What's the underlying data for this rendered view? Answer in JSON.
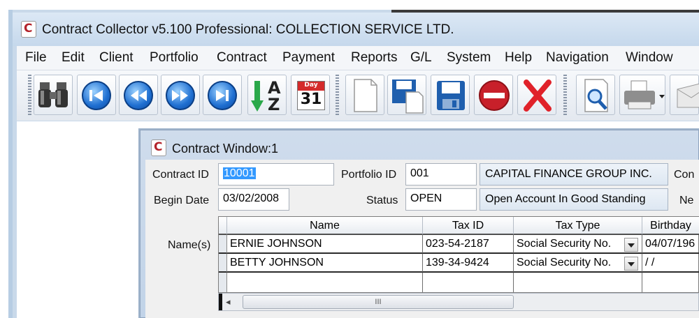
{
  "app": {
    "title": "Contract Collector v5.100 Professional:  COLLECTION SERVICE LTD."
  },
  "menu": [
    "File",
    "Edit",
    "Client",
    "Portfolio",
    "Contract",
    "Payment",
    "Reports",
    "G/L",
    "System",
    "Help",
    "Navigation",
    "Window"
  ],
  "toolbar": {
    "buttons": [
      "binoculars-icon",
      "first-record-icon",
      "previous-record-icon",
      "next-record-icon",
      "last-record-icon",
      "sort-az-icon",
      "calendar-icon",
      "new-document-icon",
      "save-as-icon",
      "save-icon",
      "stop-icon",
      "delete-icon",
      "print-preview-icon",
      "print-icon",
      "email-icon"
    ],
    "sort_a": "A",
    "sort_z": "Z",
    "calendar_header": "Day",
    "calendar_day": "31"
  },
  "contract_window": {
    "title": "Contract Window:1",
    "contract_id_label": "Contract ID",
    "contract_id": "10001",
    "portfolio_id_label": "Portfolio ID",
    "portfolio_id": "001",
    "portfolio_name": "CAPITAL FINANCE GROUP INC.",
    "con_label": "Con",
    "begin_date_label": "Begin Date",
    "begin_date": "03/02/2008",
    "status_label": "Status",
    "status": "OPEN",
    "status_desc": "Open Account In Good Standing",
    "ne_label": "Ne",
    "names_label": "Name(s)",
    "grid": {
      "columns": [
        "Name",
        "Tax ID",
        "Tax Type",
        "Birthday"
      ],
      "rows": [
        {
          "name": "ERNIE JOHNSON",
          "tax_id": "023-54-2187",
          "tax_type": "Social Security No.",
          "birthday": "04/07/196"
        },
        {
          "name": "BETTY JOHNSON",
          "tax_id": "139-34-9424",
          "tax_type": "Social Security No.",
          "birthday": "/ /"
        }
      ]
    },
    "scroll_thumb": "III"
  },
  "colors": {
    "titlebar": "#c5d8ec",
    "toolbar_blue": "#1f6fd1",
    "selection": "#3399ff"
  }
}
